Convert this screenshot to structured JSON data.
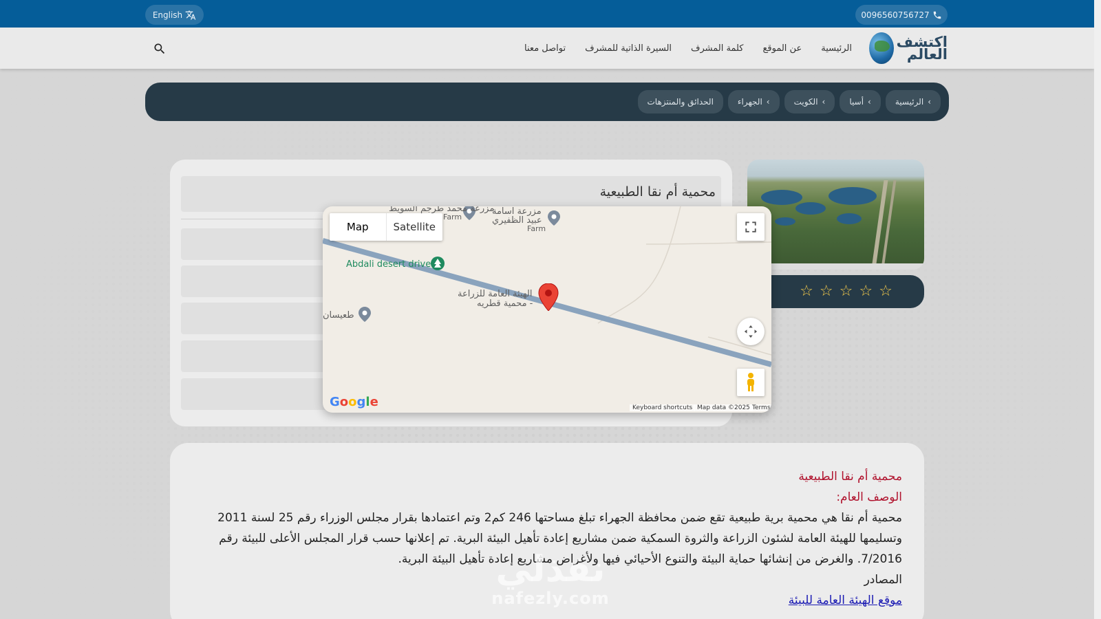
{
  "topbar": {
    "phone": "0096560756727",
    "language": "English"
  },
  "logo": {
    "line1": "اكتشف",
    "line2": "العالم"
  },
  "nav": {
    "items": [
      "الرئيسية",
      "عن الموقع",
      "كلمة المشرف",
      "السيرة الذاتية للمشرف",
      "تواصل معنا"
    ]
  },
  "breadcrumb": {
    "items": [
      "الرئيسية",
      "أسيا",
      "الكويت",
      "الجهراء",
      "الحدائق والمنتزهات"
    ]
  },
  "place": {
    "title": "محمية أم نقا الطبيعية"
  },
  "rating": {
    "stars": 5,
    "filled": 0
  },
  "map": {
    "type_map": "Map",
    "type_satellite": "Satellite",
    "labels": {
      "farm1": "مزرعة محمد طرجم السويط",
      "farm1_sub": "Farm",
      "farm2_l1": "مزرعة اسامة",
      "farm2_l2": "عبيد الظفيري",
      "farm2_sub": "Farm",
      "poi_park": "Abdali desert drive",
      "pin_l1": "الهيئة العامة للزراعة",
      "pin_l2": "- محمية قطريه",
      "poi_left": "طعيسان"
    },
    "attribution": {
      "keyboard": "Keyboard shortcuts",
      "data": "Map data ©2025",
      "terms": "Terms"
    },
    "google": "Google"
  },
  "description": {
    "title": "محمية أم نقا الطبيعية",
    "heading": "الوصف العام:",
    "body": "محمية أم نقا هي محمية برية طبيعية تقع ضمن محافظة الجهراء تبلغ مساحتها 246 كم2 وتم اعتمادها بقرار مجلس الوزراء رقم 25 لسنة 2011 وتسليمها للهيئة العامة لشئون الزراعة والثروة السمكية ضمن مشاريع إعادة تأهيل البيئة البرية. تم إعلانها حسب قرار المجلس الأعلى للبيئة رقم 7/2016. والغرض من إنشائها حماية البيئة والتنوع الأحيائي فيها ولأغراض مشاريع إعادة تأهيل البيئة البرية.",
    "sources_label": "المصادر",
    "source_link": "موقع الهيئة العامة للبيئة"
  },
  "watermark": {
    "ar": "نفذلي",
    "en": "nafezly.com"
  }
}
